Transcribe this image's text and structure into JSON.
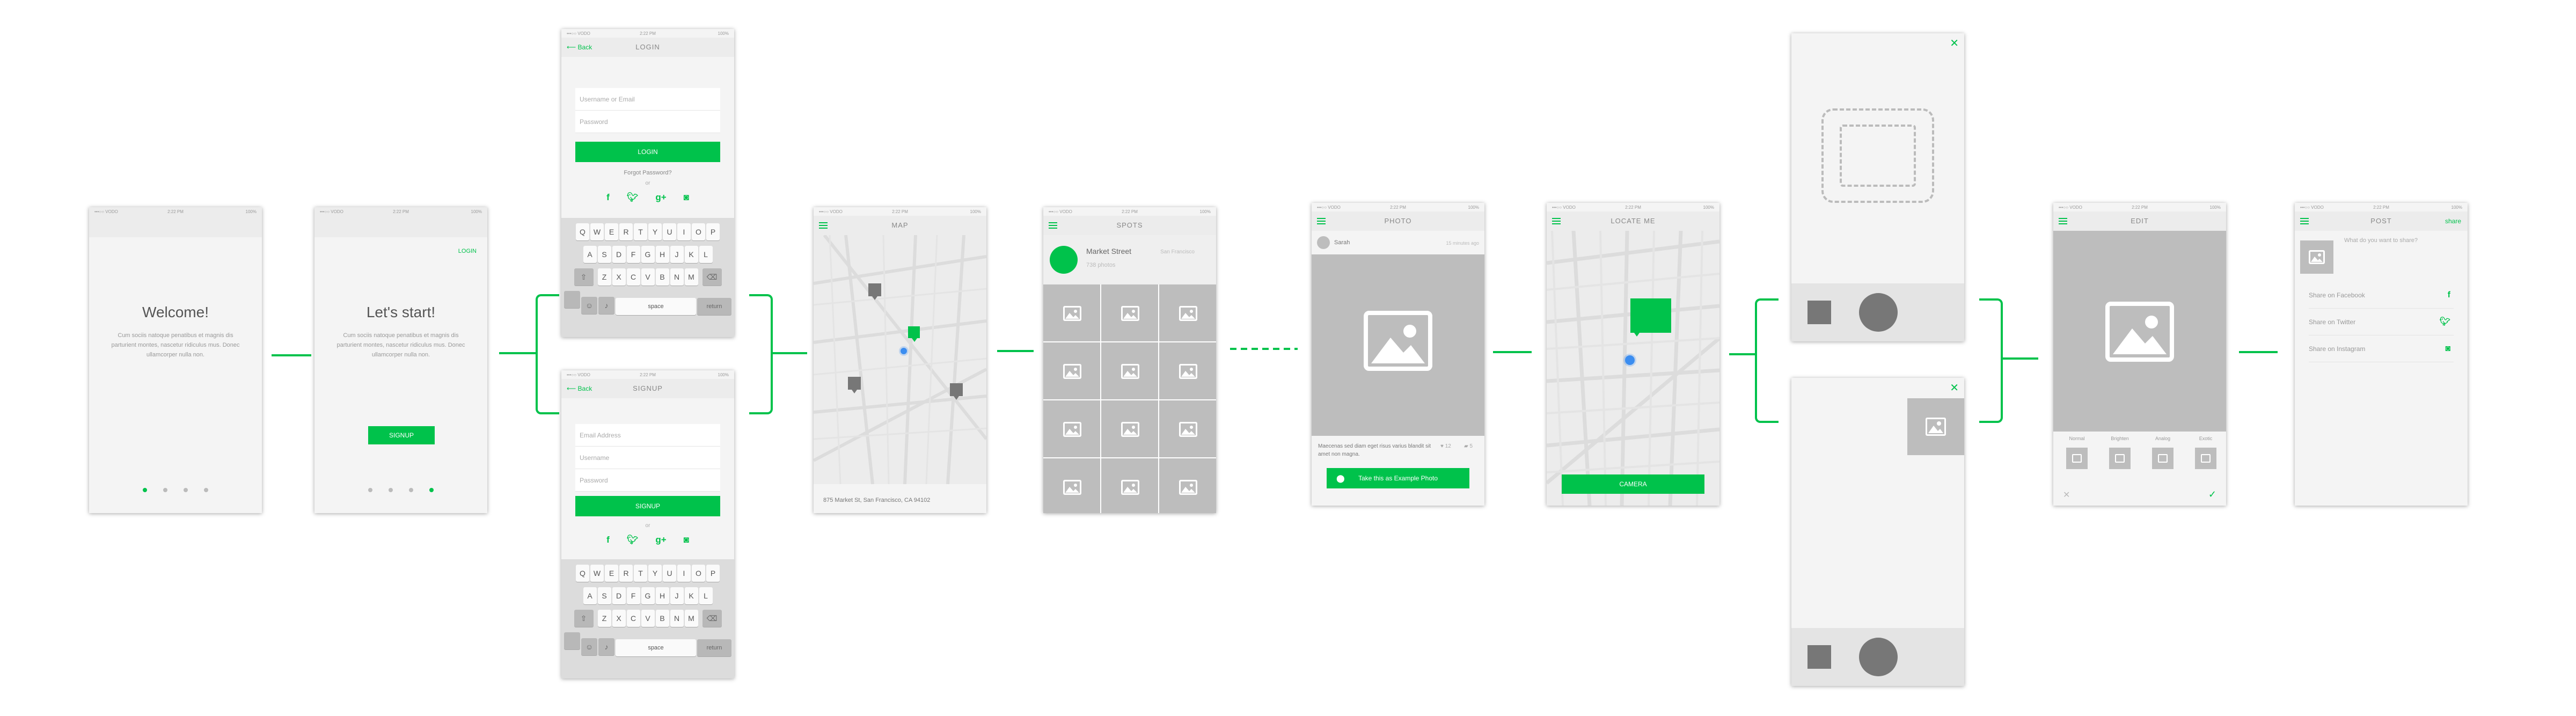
{
  "colors": {
    "accent": "#00c24b",
    "placeholder": "#bdbdbd",
    "location": "#3b8df0"
  },
  "status": {
    "carrier": "•••○○ VODO",
    "time": "2:22 PM",
    "battery": "100%"
  },
  "welcome": {
    "title": "Welcome!",
    "body": "Cum sociis natoque penatibus et magnis dis parturient montes, nascetur ridiculus mus. Donec ullamcorper nulla non."
  },
  "start": {
    "title": "Let's start!",
    "login_link": "LOGIN",
    "body": "Cum sociis natoque penatibus et magnis dis parturient montes, nascetur ridiculus mus. Donec ullamcorper nulla non.",
    "signup_button": "SIGNUP"
  },
  "login": {
    "back": "Back",
    "title": "LOGIN",
    "username_placeholder": "Username or Email",
    "password_placeholder": "Password",
    "button": "LOGIN",
    "forgot": "Forgot Password?",
    "or": "or"
  },
  "signup": {
    "back": "Back",
    "title": "SIGNUP",
    "email_placeholder": "Email Address",
    "username_placeholder": "Username",
    "password_placeholder": "Password",
    "button": "SIGNUP",
    "or": "or"
  },
  "keyboard": {
    "row1": [
      "Q",
      "W",
      "E",
      "R",
      "T",
      "Y",
      "U",
      "I",
      "O",
      "P"
    ],
    "row2": [
      "A",
      "S",
      "D",
      "F",
      "G",
      "H",
      "J",
      "K",
      "L"
    ],
    "row3": [
      "Z",
      "X",
      "C",
      "V",
      "B",
      "N",
      "M"
    ],
    "space": "space",
    "return": "return",
    "shift_icon": "shift-icon",
    "delete_icon": "delete-icon"
  },
  "map_screen": {
    "title": "MAP",
    "address": "875 Market St, San Francisco, CA 94102"
  },
  "spots": {
    "title": "SPOTS",
    "place_name": "Market Street",
    "place_city": "San Francisco",
    "place_sub": "738 photos"
  },
  "photo": {
    "title": "PHOTO",
    "user": "Sarah",
    "time_ago": "15 minutes ago",
    "caption": "Maecenas sed diam eget risus varius blandit sit amet non magna.",
    "likes": "12",
    "comments": "5",
    "button": "Take this as Example Photo"
  },
  "locate": {
    "title": "LOCATE ME",
    "button": "CAMERA"
  },
  "edit": {
    "title": "EDIT",
    "filters": [
      "Normal",
      "Brighten",
      "Analog",
      "Exotic"
    ]
  },
  "post": {
    "title": "POST",
    "share": "share",
    "placeholder": "What do you want to share?",
    "options": [
      "Share on Facebook",
      "Share on Twitter",
      "Share on Instagram"
    ]
  }
}
